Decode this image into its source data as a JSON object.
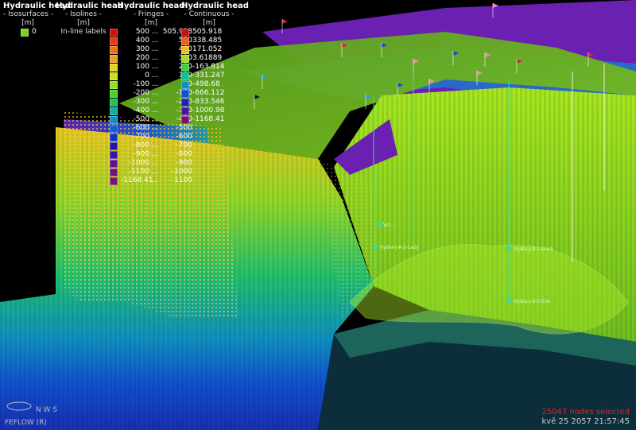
{
  "legends": {
    "isosurfaces": {
      "title": "Hydraulic head",
      "subtitle": "- Isosurfaces -",
      "unit": "[m]",
      "items": [
        {
          "value": "0",
          "color": "#7fd020"
        }
      ]
    },
    "isolines": {
      "title": "Hydraulic head",
      "subtitle": "- Isolines -",
      "unit": "[m]",
      "note": "In-line labels"
    },
    "fringes": {
      "title": "Hydraulic head",
      "subtitle": "- Fringes -",
      "unit": "[m]",
      "rows": [
        {
          "a": "500",
          "b": "...",
          "c": "505.918",
          "color": "#d01010"
        },
        {
          "a": "400",
          "b": "...",
          "c": "500",
          "color": "#e04010"
        },
        {
          "a": "300",
          "b": "...",
          "c": "400",
          "color": "#f07018"
        },
        {
          "a": "200",
          "b": "...",
          "c": "300",
          "color": "#f0a020"
        },
        {
          "a": "100",
          "b": "...",
          "c": "200",
          "color": "#e8d020"
        },
        {
          "a": "0",
          "b": "...",
          "c": "100",
          "color": "#c8e020"
        },
        {
          "a": "-100",
          "b": "...",
          "c": "0",
          "color": "#90e020"
        },
        {
          "a": "-200",
          "b": "...",
          "c": "-100",
          "color": "#50d030"
        },
        {
          "a": "-300",
          "b": "...",
          "c": "-200",
          "color": "#20c060"
        },
        {
          "a": "-400",
          "b": "...",
          "c": "-300",
          "color": "#10b0a0"
        },
        {
          "a": "-500",
          "b": "...",
          "c": "-400",
          "color": "#1090c8"
        },
        {
          "a": "-600",
          "b": "...",
          "c": "-500",
          "color": "#1060d0"
        },
        {
          "a": "-700",
          "b": "...",
          "c": "-600",
          "color": "#1030c8"
        },
        {
          "a": "-800",
          "b": "...",
          "c": "-700",
          "color": "#2010b0"
        },
        {
          "a": "-900",
          "b": "...",
          "c": "-800",
          "color": "#4010a0"
        },
        {
          "a": "-1000",
          "b": "...",
          "c": "-900",
          "color": "#601090"
        },
        {
          "a": "-1100",
          "b": "...",
          "c": "-1000",
          "color": "#701080"
        },
        {
          "a": "-1168.41",
          "b": "...",
          "c": "-1100",
          "color": "#801070"
        }
      ]
    },
    "continuous": {
      "title": "Hydraulic head",
      "subtitle": "- Continuous -",
      "unit": "[m]",
      "rows": [
        {
          "v": "505.918",
          "color": "#d01010"
        },
        {
          "v": "338.485",
          "color": "#f06018"
        },
        {
          "v": "171.052",
          "color": "#e8c020"
        },
        {
          "v": "3.61889",
          "color": "#a0e020"
        },
        {
          "v": "-163.814",
          "color": "#40d040"
        },
        {
          "v": "-331.247",
          "color": "#10c090"
        },
        {
          "v": "-498.68",
          "color": "#1090c8"
        },
        {
          "v": "-666.112",
          "color": "#1050d0"
        },
        {
          "v": "-833.546",
          "color": "#2020c0"
        },
        {
          "v": "-1000.98",
          "color": "#5010a0"
        },
        {
          "v": "-1168.41",
          "color": "#801070"
        }
      ]
    }
  },
  "wells": [
    {
      "label": "Vrt..."
    },
    {
      "label": "Vydra-J-K-2-Lazy"
    },
    {
      "label": "Vydra-J-K-1-Dusk"
    },
    {
      "label": "Vydra-J-K-3-Eve"
    }
  ],
  "status": {
    "selected": "25047 nodes selected",
    "timestamp": "kvě 25 2057 21:57:45"
  },
  "compass": {
    "label": "N W S"
  },
  "brand": "FEFLOW (R)"
}
